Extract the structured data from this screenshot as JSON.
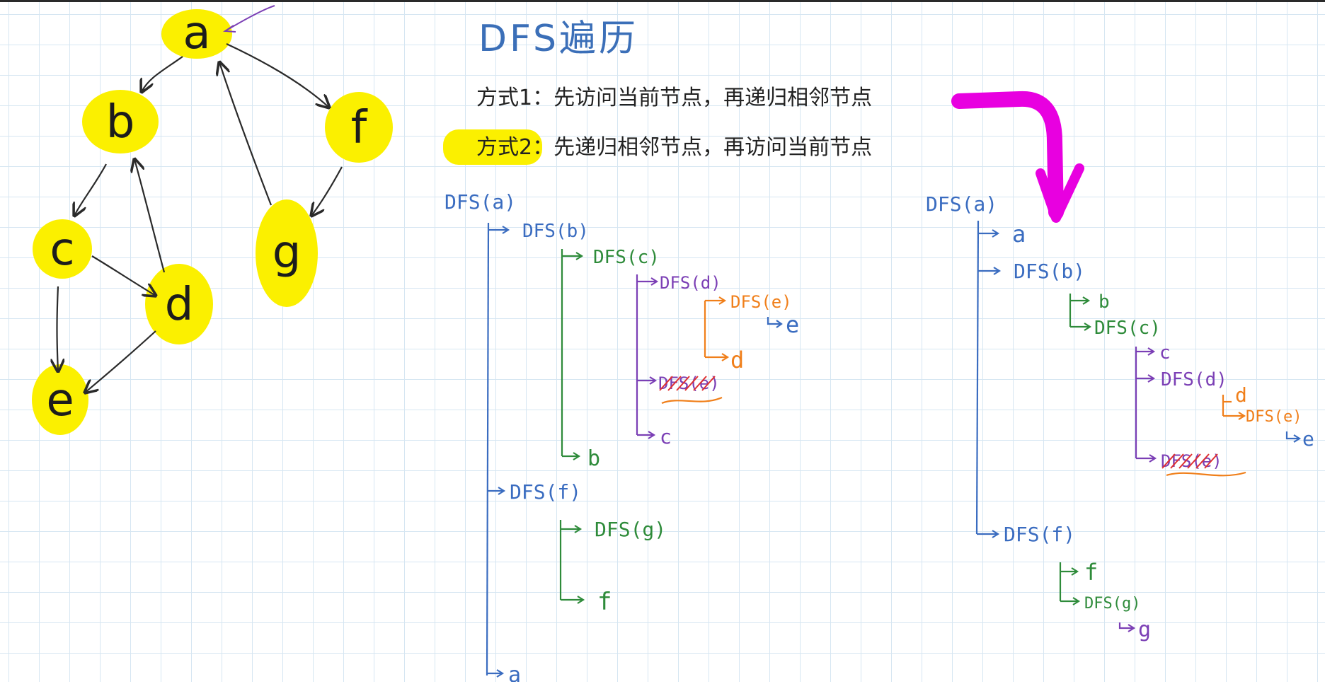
{
  "title": "DFS遍历",
  "methods": {
    "m1": "方式1：先访问当前节点，再递归相邻节点",
    "m2": "方式2：先递归相邻节点，再访问当前节点"
  },
  "graph": {
    "nodes": [
      "a",
      "b",
      "f",
      "c",
      "g",
      "d",
      "e"
    ],
    "edges": [
      [
        "a",
        "b"
      ],
      [
        "a",
        "f"
      ],
      [
        "b",
        "c"
      ],
      [
        "c",
        "d"
      ],
      [
        "c",
        "e"
      ],
      [
        "d",
        "b"
      ],
      [
        "d",
        "e"
      ],
      [
        "f",
        "g"
      ],
      [
        "g",
        "a"
      ]
    ]
  },
  "colors": {
    "grid": "#d6e6f2",
    "highlight": "#fbf000",
    "level1": "#3a6cc0",
    "level2": "#2e8b3a",
    "level3": "#7b3fb5",
    "level4": "#f07f1a",
    "strike": "#e03030",
    "arrow": "#e800e0"
  },
  "left_trace": {
    "root": "DFS(a)",
    "dfs_b": "DFS(b)",
    "dfs_c": "DFS(c)",
    "dfs_d": "DFS(d)",
    "dfs_e": "DFS(e)",
    "visit_e": "e",
    "visit_d": "d",
    "dfs_e_skip": "DFS(e)",
    "visit_c": "c",
    "visit_b": "b",
    "dfs_f": "DFS(f)",
    "dfs_g": "DFS(g)",
    "visit_f": "f",
    "visit_a": "a"
  },
  "right_trace": {
    "root": "DFS(a)",
    "visit_a": "a",
    "dfs_b": "DFS(b)",
    "visit_b": "b",
    "dfs_c": "DFS(c)",
    "visit_c": "c",
    "dfs_d": "DFS(d)",
    "visit_d": "d",
    "dfs_e": "DFS(e)",
    "visit_e": "e",
    "dfs_e_skip": "DFS(e)",
    "dfs_f": "DFS(f)",
    "visit_f": "f",
    "dfs_g": "DFS(g)",
    "visit_g": "g"
  }
}
